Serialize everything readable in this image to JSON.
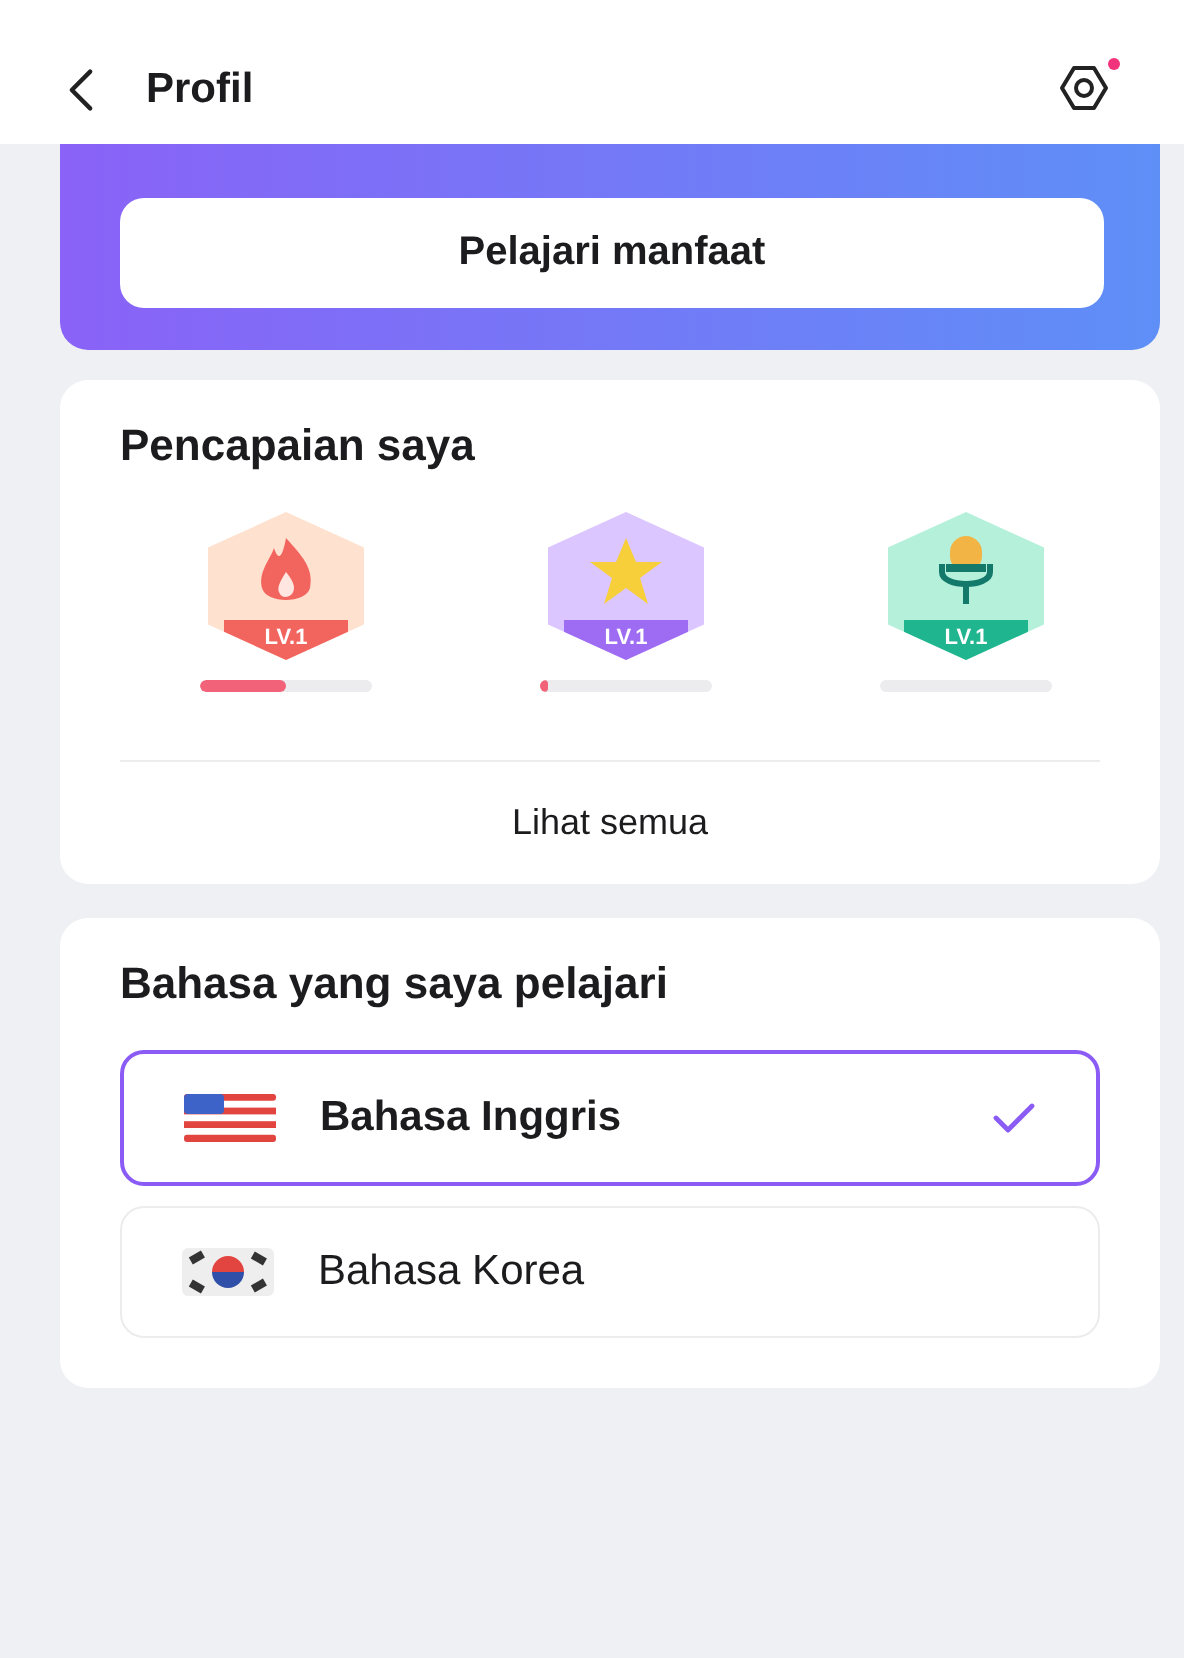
{
  "header": {
    "title": "Profil",
    "settings_notification": true
  },
  "premium": {
    "button": "Pelajari manfaat"
  },
  "achievements": {
    "title": "Pencapaian saya",
    "badges": [
      {
        "kind": "fire",
        "label": "LV.1",
        "level": 0.5
      },
      {
        "kind": "star",
        "label": "LV.1",
        "level": 0.05
      },
      {
        "kind": "mic",
        "label": "LV.1"
      }
    ],
    "see_all": "Lihat semua"
  },
  "languages": {
    "title": "Bahasa yang saya pelajari",
    "items": [
      {
        "kind": "us_flag",
        "name": "Bahasa Inggris",
        "selected": true
      },
      {
        "kind": "kr_flag",
        "name": "Bahasa Korea",
        "selected": false
      }
    ]
  }
}
